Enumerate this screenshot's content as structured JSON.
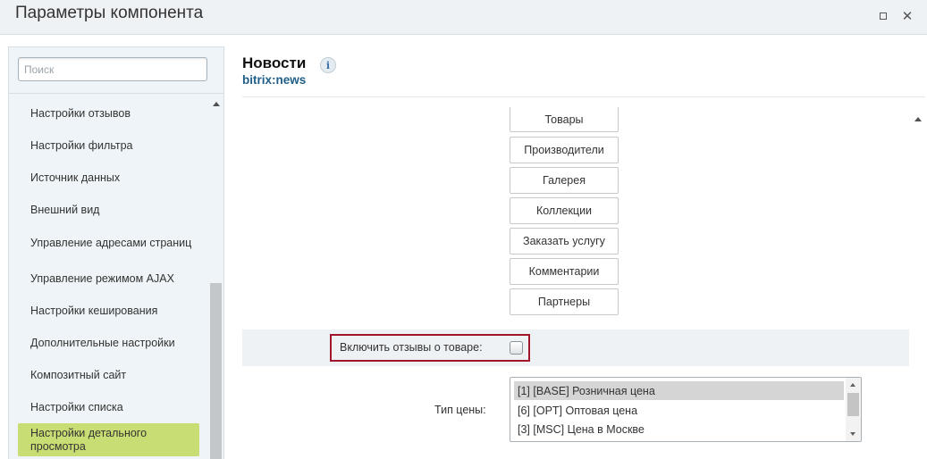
{
  "window": {
    "title": "Параметры компонента"
  },
  "sidebar": {
    "search_placeholder": "Поиск",
    "items": [
      {
        "label": "Настройки отзывов"
      },
      {
        "label": "Настройки фильтра"
      },
      {
        "label": "Источник данных"
      },
      {
        "label": "Внешний вид"
      },
      {
        "label": "Управление адресами страниц"
      },
      {
        "label": "Управление режимом AJAX"
      },
      {
        "label": "Настройки кеширования"
      },
      {
        "label": "Дополнительные настройки"
      },
      {
        "label": "Композитный сайт"
      },
      {
        "label": "Настройки списка"
      },
      {
        "label": "Настройки детального просмотра",
        "active": true
      }
    ]
  },
  "component": {
    "title": "Новости",
    "code": "bitrix:news"
  },
  "list_buttons": [
    "Товары",
    "Производители",
    "Галерея",
    "Коллекции",
    "Заказать услугу",
    "Комментарии",
    "Партнеры"
  ],
  "review_option": {
    "label": "Включить отзывы о товаре:",
    "checked": false
  },
  "price_type": {
    "label": "Тип цены:",
    "options": [
      {
        "label": "[1] [BASE] Розничная цена",
        "selected": true
      },
      {
        "label": "[6] [OPT] Оптовая цена",
        "selected": false
      },
      {
        "label": "[3] [MSC] Цена в Москве",
        "selected": false
      }
    ]
  },
  "colors": {
    "active_item": "#c8dd73",
    "highlight_border": "#a1162b",
    "code_link": "#1f5e86"
  }
}
